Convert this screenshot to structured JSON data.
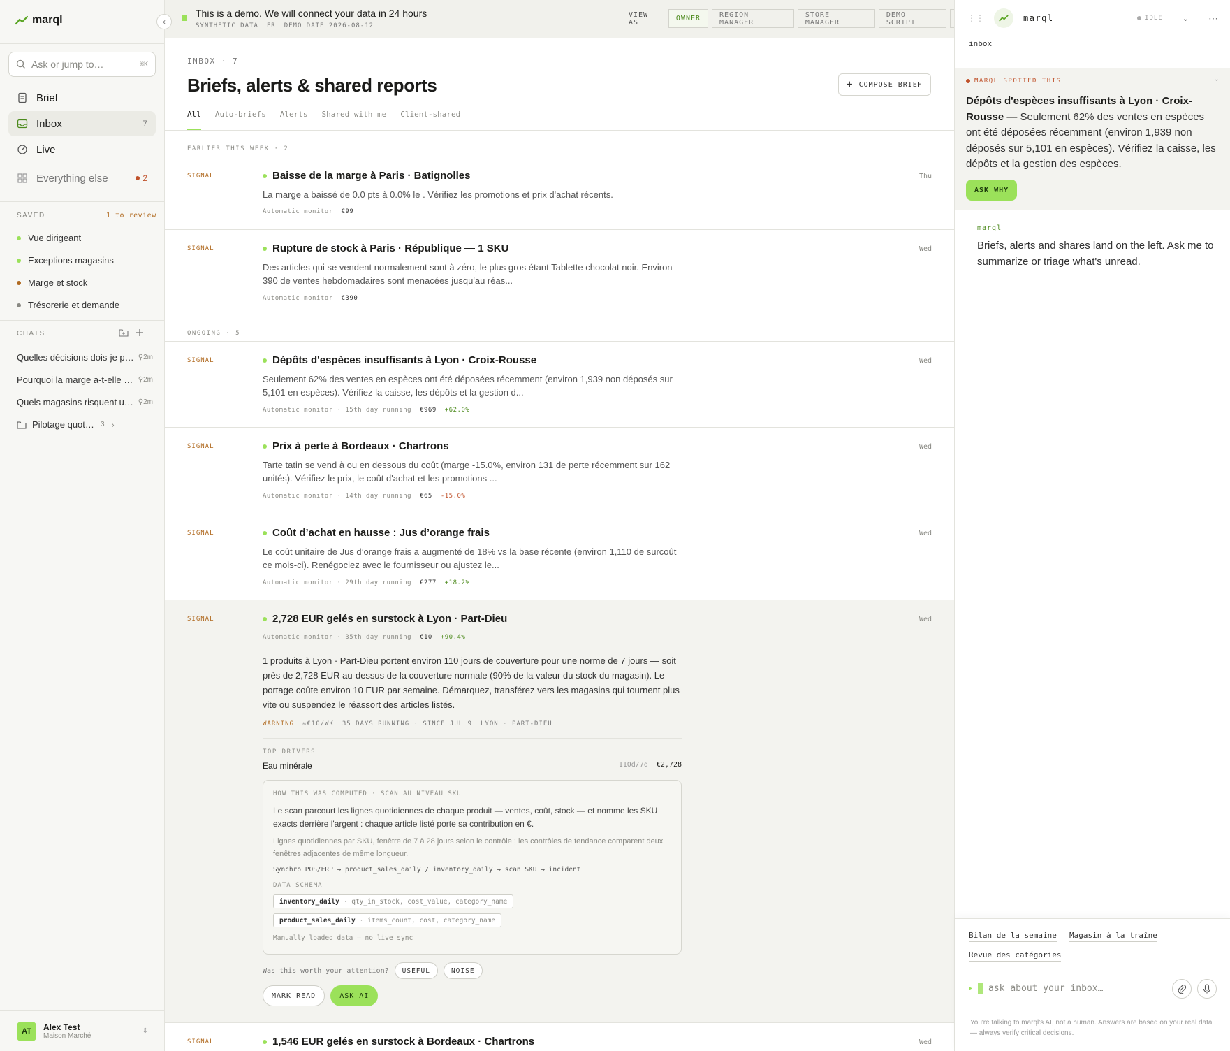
{
  "app": {
    "name": "marql"
  },
  "sidebar": {
    "search_placeholder": "Ask or jump to…",
    "search_shortcut": "⌘K",
    "nav": [
      {
        "label": "Brief",
        "icon": "document-icon"
      },
      {
        "label": "Inbox",
        "icon": "inbox-icon",
        "count": "7"
      },
      {
        "label": "Live",
        "icon": "gauge-icon"
      },
      {
        "label": "Everything else",
        "icon": "grid-icon",
        "count": "2"
      }
    ],
    "saved_label": "SAVED",
    "saved_review": "1 to review",
    "saved": [
      {
        "label": "Vue dirigeant",
        "color": "#9be15a"
      },
      {
        "label": "Exceptions magasins",
        "color": "#9be15a"
      },
      {
        "label": "Marge et stock",
        "color": "#b06a20"
      },
      {
        "label": "Trésorerie et demande",
        "color": "#8a8a84"
      }
    ],
    "chats_label": "CHATS",
    "chats": [
      {
        "label": "Quelles décisions dois-je prendre",
        "meta": "2m"
      },
      {
        "label": "Pourquoi la marge a-t-elle baissé",
        "meta": "2m"
      },
      {
        "label": "Quels magasins risquent une rupture",
        "meta": "2m"
      }
    ],
    "folder": {
      "label": "Pilotage quotidien",
      "count": "3"
    },
    "user": {
      "initials": "AT",
      "name": "Alex Test",
      "org": "Maison Marché"
    }
  },
  "topbar": {
    "demo_title": "This is a demo. We will connect your data in 24 hours",
    "demo_tags": [
      "SYNTHETIC DATA",
      "FR",
      "DEMO DATE 2026-08-12"
    ],
    "view_as": "VIEW AS",
    "roles": [
      "OWNER",
      "REGION MANAGER",
      "STORE MANAGER",
      "DEMO SCRIPT"
    ]
  },
  "main": {
    "inbox_count": "INBOX · 7",
    "title": "Briefs, alerts & shared reports",
    "compose": "COMPOSE BRIEF",
    "tabs": [
      "All",
      "Auto-briefs",
      "Alerts",
      "Shared with me",
      "Client-shared"
    ],
    "groups": {
      "earlier": "EARLIER THIS WEEK · 2",
      "ongoing": "ONGOING · 5"
    },
    "items": [
      {
        "kind": "SIGNAL",
        "title": "Baisse de la marge à Paris · Batignolles",
        "day": "Thu",
        "desc": "La marge a baissé de 0.0 pts à 0.0% le . Vérifiez les promotions et prix d'achat récents.",
        "source": "Automatic monitor",
        "amount": "€99"
      },
      {
        "kind": "SIGNAL",
        "title": "Rupture de stock à Paris · République — 1 SKU",
        "day": "Wed",
        "desc": "Des articles qui se vendent normalement sont à zéro, le plus gros étant Tablette chocolat noir. Environ 390 de ventes hebdomadaires sont menacées jusqu'au réas...",
        "source": "Automatic monitor",
        "amount": "€390"
      },
      {
        "kind": "SIGNAL",
        "title": "Dépôts d'espèces insuffisants à Lyon · Croix-Rousse",
        "day": "Wed",
        "desc": "Seulement 62% des ventes en espèces ont été déposées récemment (environ 1,939 non déposés sur 5,101 en espèces). Vérifiez la caisse, les dépôts et la gestion d...",
        "source": "Automatic monitor · 15th day running",
        "amount": "€969",
        "delta": "+62.0%"
      },
      {
        "kind": "SIGNAL",
        "title": "Prix à perte à Bordeaux · Chartrons",
        "day": "Wed",
        "desc": "Tarte tatin se vend à ou en dessous du coût (marge -15.0%, environ 131 de perte récemment sur 162 unités). Vérifiez le prix, le coût d'achat et les promotions ...",
        "source": "Automatic monitor · 14th day running",
        "amount": "€65",
        "delta": "-15.0%"
      },
      {
        "kind": "SIGNAL",
        "title": "Coût d’achat en hausse : Jus d’orange frais",
        "day": "Wed",
        "desc": "Le coût unitaire de Jus d’orange frais a augmenté de 18% vs la base récente (environ 1,110 de surcoût ce mois-ci). Renégociez avec le fournisseur ou ajustez le...",
        "source": "Automatic monitor · 29th day running",
        "amount": "€277",
        "delta": "+18.2%"
      },
      {
        "kind": "SIGNAL",
        "title": "2,728 EUR gelés en surstock à Lyon · Part-Dieu",
        "day": "Wed",
        "source": "Automatic monitor · 35th day running",
        "amount": "€10",
        "delta": "+90.4%",
        "body": "1 produits à Lyon · Part-Dieu portent environ 110 jours de couverture pour une norme de 7 jours — soit près de 2,728 EUR au-dessus de la couverture normale (90% de la valeur du stock du magasin). Le portage coûte environ 10 EUR par semaine. Démarquez, transférez vers les magasins qui tournent plus vite ou suspendez le réassort des articles listés.",
        "warn": [
          "WARNING",
          "≈€10/WK",
          "35 DAYS RUNNING · SINCE JUL 9",
          "LYON · PART-DIEU"
        ],
        "drivers_label": "TOP DRIVERS",
        "driver": {
          "name": "Eau minérale",
          "cover": "110d/7d",
          "value": "€2,728"
        },
        "how": {
          "label": "HOW THIS WAS COMPUTED · SCAN AU NIVEAU SKU",
          "p1": "Le scan parcourt les lignes quotidiennes de chaque produit — ventes, coût, stock — et nomme les SKU exacts derrière l'argent : chaque article listé porte sa contribution en €.",
          "p2": "Lignes quotidiennes par SKU, fenêtre de 7 à 28 jours selon le contrôle ; les contrôles de tendance comparent deux fenêtres adjacentes de même longueur.",
          "pipe": "Synchro POS/ERP → product_sales_daily / inventory_daily → scan SKU → incident",
          "schema_label": "DATA SCHEMA",
          "schema": [
            {
              "table": "inventory_daily",
              "cols": "· qty_in_stock, cost_value, category_name"
            },
            {
              "table": "product_sales_daily",
              "cols": "· items_count, cost, category_name"
            }
          ],
          "manual": "Manually loaded data — no live sync"
        },
        "worth": "Was this worth your attention?",
        "useful": "USEFUL",
        "noise": "NOISE",
        "mark_read": "MARK READ",
        "ask_ai": "ASK AI"
      },
      {
        "kind": "SIGNAL",
        "title": "1,546 EUR gelés en surstock à Bordeaux · Chartrons",
        "day": "Wed"
      }
    ]
  },
  "right": {
    "name": "marql",
    "status": "IDLE",
    "context": "inbox",
    "spotted_label": "MARQL SPOTTED THIS",
    "spotted_title": "Dépôts d'espèces insuffisants à Lyon · Croix-Rousse —",
    "spotted_text": " Seulement 62% des ventes en espèces ont été déposées récemment (environ 1,939 non déposés sur 5,101 en espèces). Vérifiez la caisse, les dépôts et la gestion des espèces.",
    "ask_why": "ASK WHY",
    "msg_from": "marql",
    "msg": "Briefs, alerts and shares land on the left. Ask me to summarize or triage what's unread.",
    "suggestions": [
      "Bilan de la semaine",
      "Magasin à la traîne",
      "Revue des catégories"
    ],
    "input_placeholder": "ask about your inbox…",
    "disclaimer": "You're talking to marql's AI, not a human. Answers are based on your real data — always verify critical decisions."
  }
}
